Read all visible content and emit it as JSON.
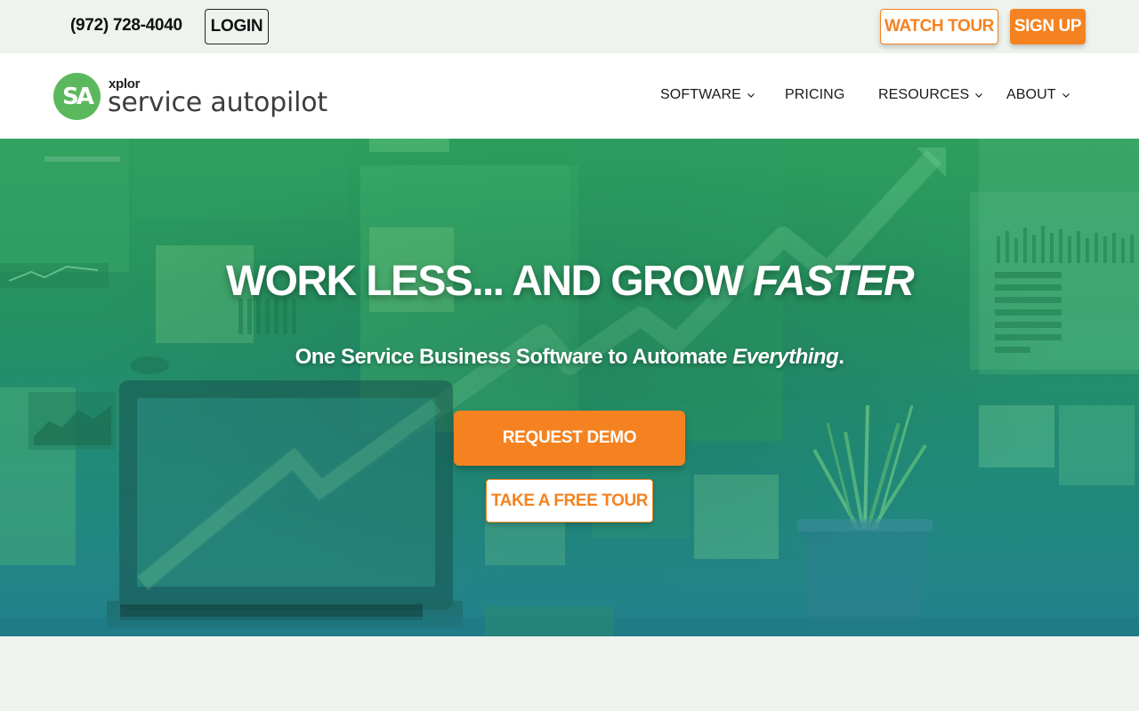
{
  "topbar": {
    "phone": "(972) 728-4040",
    "login_label": "LOGIN",
    "watch_tour_label": "WATCH TOUR",
    "sign_up_label": "SIGN UP"
  },
  "logo": {
    "mark": "SA",
    "brand_small": "xplor",
    "brand_name": "service autopilot"
  },
  "nav": {
    "items": [
      {
        "label": "SOFTWARE",
        "has_dropdown": true
      },
      {
        "label": "PRICING",
        "has_dropdown": false
      },
      {
        "label": "RESOURCES",
        "has_dropdown": true
      },
      {
        "label": "ABOUT",
        "has_dropdown": true
      }
    ]
  },
  "hero": {
    "headline_main": "WORK LESS... AND GROW ",
    "headline_emphasis": "FASTER",
    "subhead_main": "One Service Business Software to Automate ",
    "subhead_emphasis": "Everything",
    "subhead_end": ".",
    "primary_cta": "REQUEST DEMO",
    "secondary_cta": "TAKE A FREE TOUR"
  },
  "colors": {
    "accent_orange": "#f58220",
    "logo_green": "#5cb85c",
    "hero_green": "#2e9e5c",
    "hero_teal": "#23818c",
    "page_bg": "#eef3ee"
  }
}
